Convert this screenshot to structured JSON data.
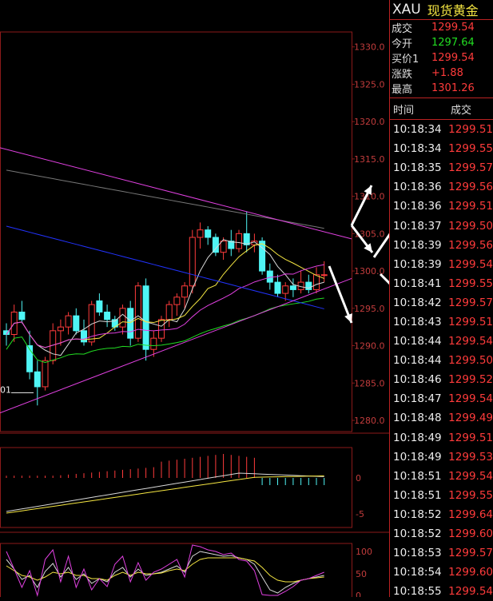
{
  "instrument": {
    "code": "XAU",
    "name": "现货黄金"
  },
  "quote": [
    {
      "label": "成交",
      "value": "1299.54",
      "color": "#ff3b3b"
    },
    {
      "label": "今开",
      "value": "1297.64",
      "color": "#22dd22"
    },
    {
      "label": "买价1",
      "value": "1299.54",
      "color": "#ff3b3b"
    },
    {
      "label": "涨跌",
      "value": "+1.88",
      "color": "#ff3b3b"
    },
    {
      "label": "最高",
      "value": "1301.26",
      "color": "#ff3b3b"
    }
  ],
  "ticks_header": {
    "time": "时间",
    "price": "成交"
  },
  "ticks": [
    {
      "time": "10:18:34",
      "price": "1299.51"
    },
    {
      "time": "10:18:34",
      "price": "1299.55"
    },
    {
      "time": "10:18:35",
      "price": "1299.57"
    },
    {
      "time": "10:18:36",
      "price": "1299.56"
    },
    {
      "time": "10:18:36",
      "price": "1299.51"
    },
    {
      "time": "10:18:37",
      "price": "1299.50"
    },
    {
      "time": "10:18:39",
      "price": "1299.56"
    },
    {
      "time": "10:18:39",
      "price": "1299.54"
    },
    {
      "time": "10:18:41",
      "price": "1299.55"
    },
    {
      "time": "10:18:42",
      "price": "1299.57"
    },
    {
      "time": "10:18:43",
      "price": "1299.51"
    },
    {
      "time": "10:18:44",
      "price": "1299.54"
    },
    {
      "time": "10:18:44",
      "price": "1299.50"
    },
    {
      "time": "10:18:46",
      "price": "1299.52"
    },
    {
      "time": "10:18:47",
      "price": "1299.54"
    },
    {
      "time": "10:18:48",
      "price": "1299.49"
    },
    {
      "time": "10:18:49",
      "price": "1299.51"
    },
    {
      "time": "10:18:49",
      "price": "1299.53"
    },
    {
      "time": "10:18:51",
      "price": "1299.54"
    },
    {
      "time": "10:18:51",
      "price": "1299.55"
    },
    {
      "time": "10:18:52",
      "price": "1299.64"
    },
    {
      "time": "10:18:52",
      "price": "1299.60"
    },
    {
      "time": "10:18:53",
      "price": "1299.57"
    },
    {
      "time": "10:18:54",
      "price": "1299.60"
    },
    {
      "time": "10:18:55",
      "price": "1299.54"
    }
  ],
  "chart_data": {
    "type": "candlestick",
    "price_axis": {
      "ticks": [
        "1330.0",
        "1325.0",
        "1320.0",
        "1315.0",
        "1310.0",
        "1305.0",
        "1300.0",
        "1295.0",
        "1290.0",
        "1285.0",
        "1280.0"
      ],
      "range": [
        1278.5,
        1332
      ]
    },
    "low_label": "01",
    "candles": [
      {
        "o": 1292.0,
        "h": 1293.0,
        "l": 1290.0,
        "c": 1291.5
      },
      {
        "o": 1291.5,
        "h": 1295.5,
        "l": 1290.5,
        "c": 1294.5
      },
      {
        "o": 1294.5,
        "h": 1296.0,
        "l": 1293.0,
        "c": 1293.5
      },
      {
        "o": 1290.0,
        "h": 1292.0,
        "l": 1285.5,
        "c": 1286.5
      },
      {
        "o": 1286.5,
        "h": 1288.0,
        "l": 1282.0,
        "c": 1284.5
      },
      {
        "o": 1284.5,
        "h": 1288.5,
        "l": 1284.0,
        "c": 1288.0
      },
      {
        "o": 1288.0,
        "h": 1293.0,
        "l": 1287.5,
        "c": 1292.0
      },
      {
        "o": 1292.0,
        "h": 1293.5,
        "l": 1290.0,
        "c": 1292.5
      },
      {
        "o": 1292.5,
        "h": 1294.5,
        "l": 1291.5,
        "c": 1294.0
      },
      {
        "o": 1294.0,
        "h": 1295.0,
        "l": 1291.5,
        "c": 1292.0
      },
      {
        "o": 1292.0,
        "h": 1293.5,
        "l": 1290.0,
        "c": 1290.5
      },
      {
        "o": 1290.5,
        "h": 1296.0,
        "l": 1290.0,
        "c": 1295.5
      },
      {
        "o": 1296.0,
        "h": 1297.0,
        "l": 1294.0,
        "c": 1294.5
      },
      {
        "o": 1294.5,
        "h": 1295.5,
        "l": 1292.5,
        "c": 1293.5
      },
      {
        "o": 1293.5,
        "h": 1294.0,
        "l": 1292.0,
        "c": 1292.5
      },
      {
        "o": 1292.5,
        "h": 1295.5,
        "l": 1291.5,
        "c": 1295.0
      },
      {
        "o": 1295.0,
        "h": 1296.0,
        "l": 1290.0,
        "c": 1291.0
      },
      {
        "o": 1291.0,
        "h": 1298.5,
        "l": 1290.5,
        "c": 1298.0
      },
      {
        "o": 1298.0,
        "h": 1299.0,
        "l": 1288.0,
        "c": 1289.5
      },
      {
        "o": 1289.5,
        "h": 1292.0,
        "l": 1288.5,
        "c": 1291.0
      },
      {
        "o": 1291.0,
        "h": 1294.0,
        "l": 1290.5,
        "c": 1293.5
      },
      {
        "o": 1293.5,
        "h": 1296.0,
        "l": 1292.5,
        "c": 1295.5
      },
      {
        "o": 1295.5,
        "h": 1297.0,
        "l": 1294.0,
        "c": 1296.5
      },
      {
        "o": 1296.5,
        "h": 1298.5,
        "l": 1295.0,
        "c": 1298.0
      },
      {
        "o": 1298.0,
        "h": 1305.5,
        "l": 1297.0,
        "c": 1304.5
      },
      {
        "o": 1304.5,
        "h": 1306.5,
        "l": 1303.0,
        "c": 1305.5
      },
      {
        "o": 1305.5,
        "h": 1306.0,
        "l": 1303.5,
        "c": 1304.5
      },
      {
        "o": 1304.5,
        "h": 1305.0,
        "l": 1302.0,
        "c": 1302.5
      },
      {
        "o": 1302.5,
        "h": 1304.5,
        "l": 1301.5,
        "c": 1304.0
      },
      {
        "o": 1304.0,
        "h": 1305.5,
        "l": 1302.0,
        "c": 1303.0
      },
      {
        "o": 1303.0,
        "h": 1305.5,
        "l": 1302.5,
        "c": 1305.0
      },
      {
        "o": 1305.0,
        "h": 1308.0,
        "l": 1302.5,
        "c": 1303.5
      },
      {
        "o": 1303.5,
        "h": 1305.0,
        "l": 1302.5,
        "c": 1304.0
      },
      {
        "o": 1304.0,
        "h": 1304.5,
        "l": 1299.5,
        "c": 1300.0
      },
      {
        "o": 1300.0,
        "h": 1301.0,
        "l": 1297.5,
        "c": 1298.5
      },
      {
        "o": 1298.5,
        "h": 1299.5,
        "l": 1296.5,
        "c": 1297.0
      },
      {
        "o": 1297.0,
        "h": 1298.5,
        "l": 1296.0,
        "c": 1298.0
      },
      {
        "o": 1298.0,
        "h": 1299.0,
        "l": 1296.5,
        "c": 1297.5
      },
      {
        "o": 1297.5,
        "h": 1300.0,
        "l": 1297.0,
        "c": 1298.5
      },
      {
        "o": 1298.5,
        "h": 1299.5,
        "l": 1297.0,
        "c": 1297.5
      },
      {
        "o": 1297.5,
        "h": 1300.5,
        "l": 1297.0,
        "c": 1299.5
      },
      {
        "o": 1299.5,
        "h": 1301.3,
        "l": 1298.5,
        "c": 1299.5
      }
    ],
    "macd_axis": {
      "ticks": [
        "0",
        "-5"
      ]
    },
    "kdj_axis": {
      "ticks": [
        "100",
        "50",
        "0"
      ]
    },
    "colors": {
      "up": "#ff3b3b",
      "down": "#4ff5f5",
      "grid": "#8b1a1a",
      "axis_text": "#c23c3c",
      "trendline": "#e040e0",
      "ma_white": "#d8d8d8",
      "ma_yellow": "#f5e642",
      "ma_pink": "#e040e0",
      "ma_green": "#22dd22",
      "ma_blue": "#2233ff",
      "ma_gray": "#777777"
    }
  }
}
